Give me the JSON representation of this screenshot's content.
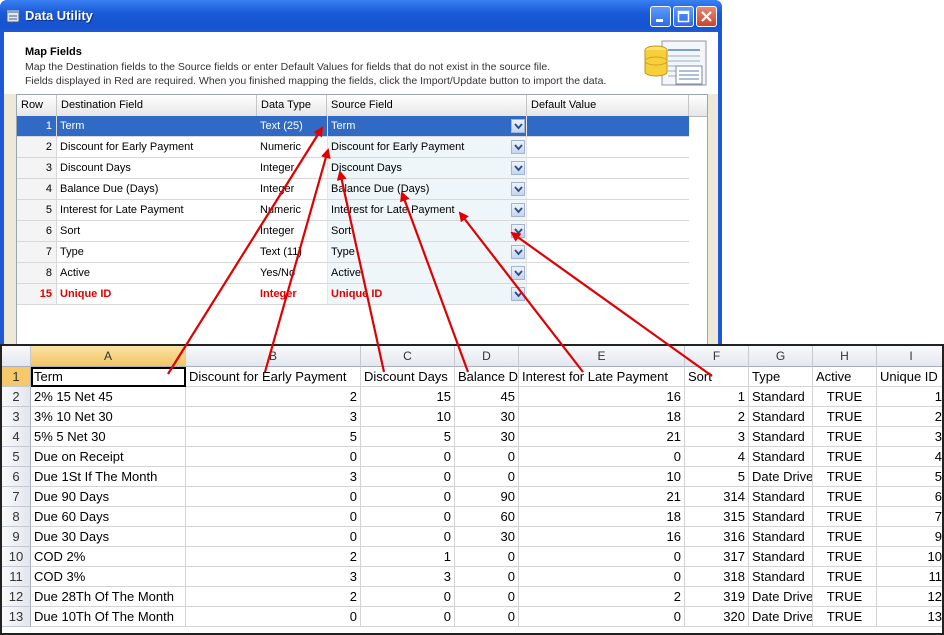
{
  "window": {
    "title": "Data Utility",
    "minimize_label": "Minimize",
    "maximize_label": "Maximize",
    "close_label": "Close"
  },
  "header": {
    "title": "Map Fields",
    "line1": "Map the Destination fields to the Source fields or enter Default Values for fields that do not exist in the source file.",
    "line2": "Fields displayed in Red are required.  When you finished mapping the fields, click the Import/Update button to import the data."
  },
  "grid": {
    "columns": [
      "Row",
      "Destination Field",
      "Data Type",
      "Source Field",
      "Default Value"
    ],
    "rows": [
      {
        "row": "1",
        "dest": "Term",
        "type": "Text (25)",
        "source": "Term",
        "default": "",
        "selected": true,
        "required": false
      },
      {
        "row": "2",
        "dest": "Discount for Early Payment",
        "type": "Numeric",
        "source": "Discount for Early Payment",
        "default": "",
        "selected": false,
        "required": false
      },
      {
        "row": "3",
        "dest": "Discount Days",
        "type": "Integer",
        "source": "Discount Days",
        "default": "",
        "selected": false,
        "required": false
      },
      {
        "row": "4",
        "dest": "Balance Due (Days)",
        "type": "Integer",
        "source": "Balance Due (Days)",
        "default": "",
        "selected": false,
        "required": false
      },
      {
        "row": "5",
        "dest": "Interest for Late Payment",
        "type": "Numeric",
        "source": "Interest for Late Payment",
        "default": "",
        "selected": false,
        "required": false
      },
      {
        "row": "6",
        "dest": "Sort",
        "type": "Integer",
        "source": "Sort",
        "default": "",
        "selected": false,
        "required": false
      },
      {
        "row": "7",
        "dest": "Type",
        "type": "Text (11)",
        "source": "Type",
        "default": "",
        "selected": false,
        "required": false
      },
      {
        "row": "8",
        "dest": "Active",
        "type": "Yes/No",
        "source": "Active",
        "default": "",
        "selected": false,
        "required": false
      },
      {
        "row": "15",
        "dest": "Unique ID",
        "type": "Integer",
        "source": "Unique ID",
        "default": "",
        "selected": false,
        "required": true
      }
    ]
  },
  "spreadsheet": {
    "columns": [
      "A",
      "B",
      "C",
      "D",
      "E",
      "F",
      "G",
      "H",
      "I"
    ],
    "rows": [
      {
        "n": "1",
        "cells": [
          "Term",
          "Discount for Early Payment",
          "Discount Days",
          "Balance Due (Days)",
          "Interest for Late Payment",
          "Sort",
          "Type",
          "Active",
          "Unique ID"
        ]
      },
      {
        "n": "2",
        "cells": [
          "2% 15 Net 45",
          "2",
          "15",
          "45",
          "16",
          "1",
          "Standard",
          "TRUE",
          "1"
        ]
      },
      {
        "n": "3",
        "cells": [
          "3% 10 Net 30",
          "3",
          "10",
          "30",
          "18",
          "2",
          "Standard",
          "TRUE",
          "2"
        ]
      },
      {
        "n": "4",
        "cells": [
          "5% 5 Net 30",
          "5",
          "5",
          "30",
          "21",
          "3",
          "Standard",
          "TRUE",
          "3"
        ]
      },
      {
        "n": "5",
        "cells": [
          "Due on Receipt",
          "0",
          "0",
          "0",
          "0",
          "4",
          "Standard",
          "TRUE",
          "4"
        ]
      },
      {
        "n": "6",
        "cells": [
          "Due 1St If The Month",
          "3",
          "0",
          "0",
          "10",
          "5",
          "Date Driven",
          "TRUE",
          "5"
        ]
      },
      {
        "n": "7",
        "cells": [
          "Due 90 Days",
          "0",
          "0",
          "90",
          "21",
          "314",
          "Standard",
          "TRUE",
          "6"
        ]
      },
      {
        "n": "8",
        "cells": [
          "Due 60 Days",
          "0",
          "0",
          "60",
          "18",
          "315",
          "Standard",
          "TRUE",
          "7"
        ]
      },
      {
        "n": "9",
        "cells": [
          "Due 30 Days",
          "0",
          "0",
          "30",
          "16",
          "316",
          "Standard",
          "TRUE",
          "9"
        ]
      },
      {
        "n": "10",
        "cells": [
          "COD 2%",
          "2",
          "1",
          "0",
          "0",
          "317",
          "Standard",
          "TRUE",
          "10"
        ]
      },
      {
        "n": "11",
        "cells": [
          "COD 3%",
          "3",
          "3",
          "0",
          "0",
          "318",
          "Standard",
          "TRUE",
          "11"
        ]
      },
      {
        "n": "12",
        "cells": [
          "Due 28Th Of The Month",
          "2",
          "0",
          "0",
          "2",
          "319",
          "Date Driven",
          "TRUE",
          "12"
        ]
      },
      {
        "n": "13",
        "cells": [
          "Due 10Th Of The Month",
          "0",
          "0",
          "0",
          "0",
          "320",
          "Date Driven",
          "TRUE",
          "13"
        ]
      }
    ]
  },
  "colors": {
    "title_bar": "#1553cf",
    "selection": "#316ac5",
    "required": "#e00000",
    "arrow": "#e00000"
  },
  "icons": {
    "app": "database-icon",
    "header": "database-table-icon",
    "dropdown": "chevron-down-icon"
  }
}
